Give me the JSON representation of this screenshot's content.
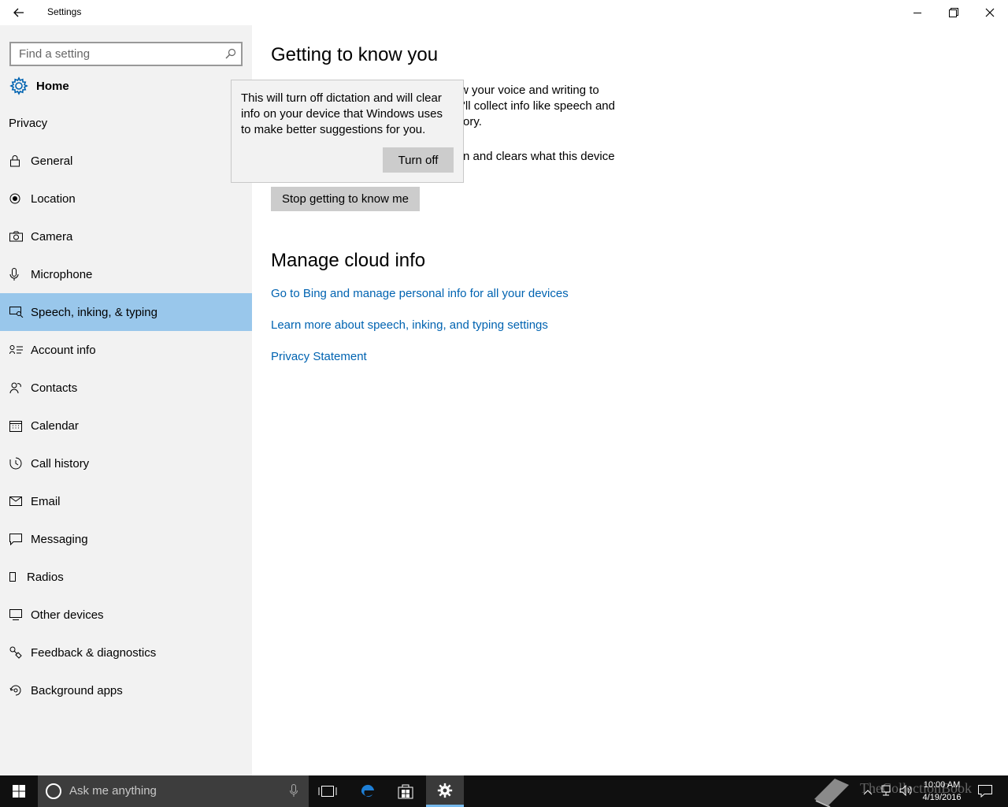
{
  "window": {
    "title": "Settings"
  },
  "sidebar": {
    "search_placeholder": "Find a setting",
    "home_label": "Home",
    "section_title": "Privacy",
    "items": [
      {
        "label": "General",
        "icon": "lock-icon"
      },
      {
        "label": "Location",
        "icon": "location-icon"
      },
      {
        "label": "Camera",
        "icon": "camera-icon"
      },
      {
        "label": "Microphone",
        "icon": "microphone-icon"
      },
      {
        "label": "Speech, inking, & typing",
        "icon": "speech-inking-icon",
        "selected": true
      },
      {
        "label": "Account info",
        "icon": "account-info-icon"
      },
      {
        "label": "Contacts",
        "icon": "contacts-icon"
      },
      {
        "label": "Calendar",
        "icon": "calendar-icon"
      },
      {
        "label": "Call history",
        "icon": "call-history-icon"
      },
      {
        "label": "Email",
        "icon": "email-icon"
      },
      {
        "label": "Messaging",
        "icon": "messaging-icon"
      },
      {
        "label": "Radios",
        "icon": "radios-icon"
      },
      {
        "label": "Other devices",
        "icon": "other-devices-icon"
      },
      {
        "label": "Feedback & diagnostics",
        "icon": "feedback-icon"
      },
      {
        "label": "Background apps",
        "icon": "background-apps-icon"
      }
    ]
  },
  "main": {
    "heading": "Getting to know you",
    "para1_lines": [
      "w your voice and writing to",
      "'ll collect info like speech and",
      "ory."
    ],
    "para2": "n and clears what this device",
    "stop_button": "Stop getting to know me",
    "heading2": "Manage cloud info",
    "links": [
      "Go to Bing and manage personal info for all your devices",
      "Learn more about speech, inking, and typing settings",
      "Privacy Statement"
    ]
  },
  "flyout": {
    "text": "This will turn off dictation and will clear info on your device that Windows uses to make better suggestions for you.",
    "button": "Turn off"
  },
  "taskbar": {
    "search_placeholder": "Ask me anything",
    "time": "10:00 AM",
    "date": "4/19/2016",
    "watermark": "TheCollectionBook"
  },
  "colors": {
    "accent": "#0063b1",
    "selected_bg": "#99c7eb",
    "sidebar_bg": "#f2f2f2",
    "taskbar_bg": "#101010"
  }
}
